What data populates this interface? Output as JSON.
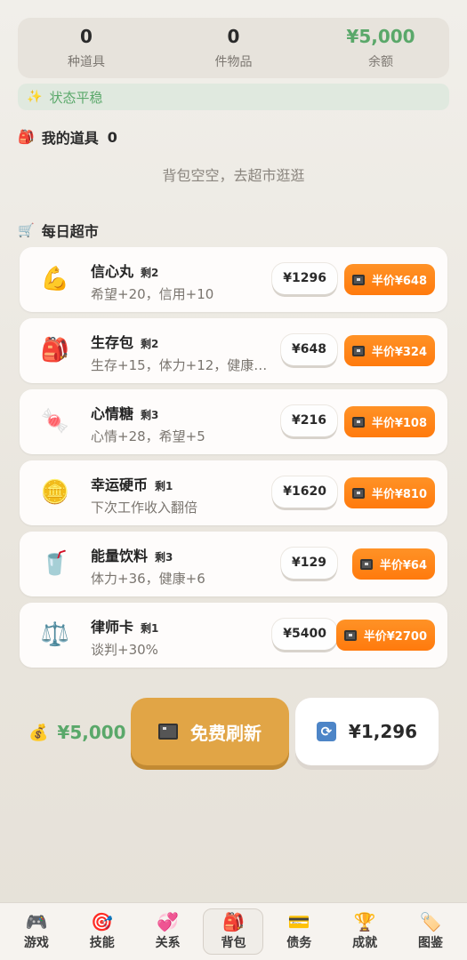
{
  "stats": [
    {
      "value": "0",
      "label": "种道具"
    },
    {
      "value": "0",
      "label": "件物品"
    },
    {
      "value": "¥5,000",
      "label": "余额"
    }
  ],
  "status": {
    "icon": "✨",
    "text": "状态平稳"
  },
  "backpack": {
    "icon": "🎒",
    "title": "我的道具",
    "count": "0",
    "empty_text": "背包空空，去超市逛逛"
  },
  "market": {
    "icon": "🛒",
    "title": "每日超市",
    "items": [
      {
        "emoji": "💪",
        "name": "信心丸",
        "remaining": "剩2",
        "desc": "希望+20，信用+10",
        "price": "¥1296",
        "half": "半价¥648"
      },
      {
        "emoji": "🎒",
        "name": "生存包",
        "remaining": "剩2",
        "desc": "生存+15，体力+12，健康…",
        "price": "¥648",
        "half": "半价¥324"
      },
      {
        "emoji": "🍬",
        "name": "心情糖",
        "remaining": "剩3",
        "desc": "心情+28，希望+5",
        "price": "¥216",
        "half": "半价¥108"
      },
      {
        "emoji": "🪙",
        "name": "幸运硬币",
        "remaining": "剩1",
        "desc": "下次工作收入翻倍",
        "price": "¥1620",
        "half": "半价¥810"
      },
      {
        "emoji": "🥤",
        "name": "能量饮料",
        "remaining": "剩3",
        "desc": "体力+36，健康+6",
        "price": "¥129",
        "half": "半价¥64"
      },
      {
        "emoji": "⚖️",
        "name": "律师卡",
        "remaining": "剩1",
        "desc": "谈判+30%",
        "price": "¥5400",
        "half": "半价¥2700"
      }
    ]
  },
  "footer": {
    "money_icon": "💰",
    "money": "¥5,000",
    "free_refresh": "免费刷新",
    "refresh_icon": "🔄",
    "refresh_price": "¥1,296"
  },
  "nav": [
    {
      "icon": "🎮",
      "label": "游戏",
      "active": false
    },
    {
      "icon": "🎯",
      "label": "技能",
      "active": false
    },
    {
      "icon": "💞",
      "label": "关系",
      "active": false
    },
    {
      "icon": "🎒",
      "label": "背包",
      "active": true
    },
    {
      "icon": "💳",
      "label": "债务",
      "active": false
    },
    {
      "icon": "🏆",
      "label": "成就",
      "active": false
    },
    {
      "icon": "🏷️",
      "label": "图鉴",
      "active": false
    }
  ],
  "colors": {
    "accent_green": "#5aa86a",
    "orange": "#ff8418",
    "gold": "#e1a546"
  }
}
